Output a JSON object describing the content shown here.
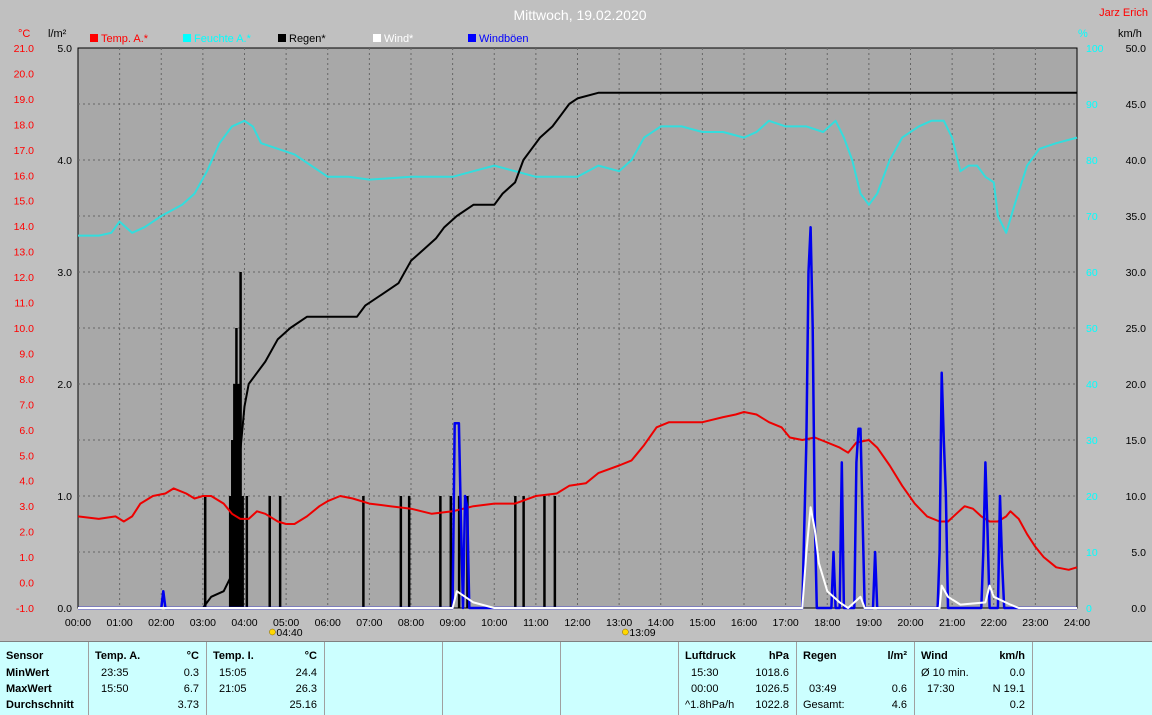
{
  "header": {
    "title": "Mittwoch, 19.02.2020",
    "author": "Jarz Erich",
    "unit_left_c": "°C",
    "unit_left_l": "l/m²",
    "unit_right_pct": "%",
    "unit_right_kmh": "km/h"
  },
  "legend": [
    {
      "label": "Temp. A.*",
      "color": "#ff0000"
    },
    {
      "label": "Feuchte A.*",
      "color": "#00ffff"
    },
    {
      "label": "Regen*",
      "color": "#000000"
    },
    {
      "label": "Wind*",
      "color": "#ffffff"
    },
    {
      "label": "Windböen",
      "color": "#0000ff"
    }
  ],
  "colors": {
    "temp": "#ee0000",
    "humidity": "#33dddd",
    "rain": "#000000",
    "wind": "#ffffff",
    "gust": "#0000ee",
    "plot_bg": "#a8a8a8",
    "grid": "#666666"
  },
  "axis_labels": {
    "temp": [
      "21.0",
      "20.0",
      "19.0",
      "18.0",
      "17.0",
      "16.0",
      "15.0",
      "14.0",
      "13.0",
      "12.0",
      "11.0",
      "10.0",
      "9.0",
      "8.0",
      "7.0",
      "6.0",
      "5.0",
      "4.0",
      "3.0",
      "2.0",
      "1.0",
      "0.0",
      "-1.0"
    ],
    "rain": [
      "5.0",
      "4.0",
      "3.0",
      "2.0",
      "1.0",
      "0.0"
    ],
    "hum": [
      "100",
      "90",
      "80",
      "70",
      "60",
      "50",
      "40",
      "30",
      "20",
      "10",
      "0"
    ],
    "wind": [
      "50.0",
      "45.0",
      "40.0",
      "35.0",
      "30.0",
      "25.0",
      "20.0",
      "15.0",
      "10.0",
      "5.0",
      "0.0"
    ],
    "time": [
      "00:00",
      "01:00",
      "02:00",
      "03:00",
      "04:00",
      "05:00",
      "06:00",
      "07:00",
      "08:00",
      "09:00",
      "10:00",
      "11:00",
      "12:00",
      "13:00",
      "14:00",
      "15:00",
      "16:00",
      "17:00",
      "18:00",
      "19:00",
      "20:00",
      "21:00",
      "22:00",
      "23:00",
      "24:00"
    ]
  },
  "sun_markers": [
    {
      "time": 4.67,
      "label": "04:40"
    },
    {
      "time": 13.15,
      "label": "13:09"
    }
  ],
  "chart_data": {
    "type": "line",
    "x_unit": "hour of day",
    "xlim": [
      0,
      24
    ],
    "axes": {
      "temp_c": [
        -1,
        21
      ],
      "rain_lm2": [
        0,
        5
      ],
      "humidity_pct": [
        0,
        100
      ],
      "wind_kmh": [
        0,
        50
      ]
    },
    "grid": true,
    "series": [
      {
        "name": "Temp. A.*",
        "axis": "temp_c",
        "points": [
          [
            0,
            2.6
          ],
          [
            0.5,
            2.5
          ],
          [
            0.9,
            2.6
          ],
          [
            1.1,
            2.4
          ],
          [
            1.3,
            2.6
          ],
          [
            1.5,
            3.1
          ],
          [
            1.8,
            3.4
          ],
          [
            2.1,
            3.5
          ],
          [
            2.3,
            3.7
          ],
          [
            2.6,
            3.5
          ],
          [
            2.8,
            3.3
          ],
          [
            3.0,
            3.4
          ],
          [
            3.2,
            3.4
          ],
          [
            3.5,
            3.1
          ],
          [
            3.7,
            2.7
          ],
          [
            3.9,
            2.5
          ],
          [
            4.1,
            2.5
          ],
          [
            4.3,
            2.8
          ],
          [
            4.5,
            2.7
          ],
          [
            4.8,
            2.4
          ],
          [
            5.0,
            2.3
          ],
          [
            5.2,
            2.3
          ],
          [
            5.5,
            2.6
          ],
          [
            5.8,
            3.0
          ],
          [
            6.0,
            3.2
          ],
          [
            6.3,
            3.4
          ],
          [
            6.6,
            3.3
          ],
          [
            7.0,
            3.1
          ],
          [
            7.5,
            3.0
          ],
          [
            8.0,
            2.9
          ],
          [
            8.5,
            2.7
          ],
          [
            9.0,
            2.8
          ],
          [
            9.5,
            3.0
          ],
          [
            10.0,
            3.1
          ],
          [
            10.5,
            3.1
          ],
          [
            11.0,
            3.4
          ],
          [
            11.5,
            3.5
          ],
          [
            11.8,
            3.8
          ],
          [
            12.2,
            3.9
          ],
          [
            12.5,
            4.3
          ],
          [
            13.0,
            4.6
          ],
          [
            13.3,
            4.8
          ],
          [
            13.6,
            5.4
          ],
          [
            13.9,
            6.1
          ],
          [
            14.2,
            6.3
          ],
          [
            14.5,
            6.3
          ],
          [
            15.0,
            6.3
          ],
          [
            15.5,
            6.5
          ],
          [
            15.8,
            6.6
          ],
          [
            16.0,
            6.7
          ],
          [
            16.3,
            6.6
          ],
          [
            16.6,
            6.3
          ],
          [
            16.9,
            6.1
          ],
          [
            17.1,
            5.7
          ],
          [
            17.4,
            5.6
          ],
          [
            17.7,
            5.7
          ],
          [
            18.0,
            5.5
          ],
          [
            18.3,
            5.3
          ],
          [
            18.5,
            5.1
          ],
          [
            18.7,
            5.5
          ],
          [
            19.0,
            5.6
          ],
          [
            19.2,
            5.3
          ],
          [
            19.5,
            4.6
          ],
          [
            19.8,
            3.8
          ],
          [
            20.1,
            3.1
          ],
          [
            20.4,
            2.6
          ],
          [
            20.7,
            2.4
          ],
          [
            20.9,
            2.4
          ],
          [
            21.1,
            2.7
          ],
          [
            21.3,
            3.0
          ],
          [
            21.5,
            2.9
          ],
          [
            21.7,
            2.6
          ],
          [
            21.9,
            2.4
          ],
          [
            22.1,
            2.4
          ],
          [
            22.3,
            2.6
          ],
          [
            22.4,
            2.8
          ],
          [
            22.6,
            2.5
          ],
          [
            22.8,
            1.9
          ],
          [
            23.0,
            1.4
          ],
          [
            23.2,
            1.0
          ],
          [
            23.5,
            0.6
          ],
          [
            23.8,
            0.5
          ],
          [
            24,
            0.6
          ]
        ]
      },
      {
        "name": "Feuchte A.*",
        "axis": "humidity_pct",
        "points": [
          [
            0,
            66.5
          ],
          [
            0.5,
            66.5
          ],
          [
            0.8,
            67
          ],
          [
            1.0,
            69
          ],
          [
            1.3,
            67
          ],
          [
            1.6,
            68
          ],
          [
            2.0,
            70
          ],
          [
            2.5,
            72
          ],
          [
            2.8,
            74
          ],
          [
            3.1,
            78
          ],
          [
            3.4,
            83
          ],
          [
            3.7,
            86
          ],
          [
            4.0,
            87
          ],
          [
            4.2,
            86
          ],
          [
            4.4,
            83
          ],
          [
            4.8,
            82
          ],
          [
            5.2,
            81
          ],
          [
            5.6,
            79
          ],
          [
            6.0,
            77
          ],
          [
            6.5,
            77
          ],
          [
            7.0,
            76.5
          ],
          [
            8.0,
            77
          ],
          [
            9.0,
            77
          ],
          [
            9.5,
            78
          ],
          [
            10.0,
            79
          ],
          [
            10.5,
            78
          ],
          [
            11.0,
            77
          ],
          [
            11.5,
            77
          ],
          [
            12.0,
            77
          ],
          [
            12.5,
            79
          ],
          [
            13.0,
            78
          ],
          [
            13.3,
            80
          ],
          [
            13.6,
            84
          ],
          [
            14.0,
            86
          ],
          [
            14.5,
            86
          ],
          [
            15.0,
            85
          ],
          [
            15.5,
            85
          ],
          [
            16.0,
            84
          ],
          [
            16.3,
            85
          ],
          [
            16.6,
            87
          ],
          [
            17.0,
            86
          ],
          [
            17.5,
            86
          ],
          [
            17.9,
            85
          ],
          [
            18.2,
            87
          ],
          [
            18.4,
            84
          ],
          [
            18.6,
            80
          ],
          [
            18.8,
            74
          ],
          [
            19.0,
            72
          ],
          [
            19.2,
            74
          ],
          [
            19.5,
            80
          ],
          [
            19.8,
            84
          ],
          [
            20.2,
            86
          ],
          [
            20.5,
            87
          ],
          [
            20.8,
            87
          ],
          [
            21.0,
            84
          ],
          [
            21.2,
            78
          ],
          [
            21.4,
            79
          ],
          [
            21.6,
            79
          ],
          [
            21.8,
            77
          ],
          [
            22.0,
            76
          ],
          [
            22.1,
            70
          ],
          [
            22.3,
            67
          ],
          [
            22.5,
            72
          ],
          [
            22.8,
            79
          ],
          [
            23.1,
            82
          ],
          [
            23.5,
            83
          ],
          [
            24,
            84
          ]
        ]
      },
      {
        "name": "Regen*",
        "axis": "rain_lm2",
        "points": [
          [
            0,
            0
          ],
          [
            3.0,
            0
          ],
          [
            3.2,
            0.1
          ],
          [
            3.5,
            0.15
          ],
          [
            3.7,
            0.3
          ],
          [
            3.8,
            0.7
          ],
          [
            3.9,
            1.4
          ],
          [
            4.0,
            1.8
          ],
          [
            4.1,
            2.0
          ],
          [
            4.3,
            2.1
          ],
          [
            4.5,
            2.2
          ],
          [
            4.8,
            2.4
          ],
          [
            5.1,
            2.5
          ],
          [
            5.5,
            2.6
          ],
          [
            6.0,
            2.6
          ],
          [
            6.7,
            2.6
          ],
          [
            6.9,
            2.7
          ],
          [
            7.3,
            2.8
          ],
          [
            7.7,
            2.9
          ],
          [
            8.0,
            3.1
          ],
          [
            8.3,
            3.2
          ],
          [
            8.6,
            3.3
          ],
          [
            8.8,
            3.4
          ],
          [
            9.1,
            3.5
          ],
          [
            9.5,
            3.6
          ],
          [
            10.0,
            3.6
          ],
          [
            10.2,
            3.7
          ],
          [
            10.5,
            3.8
          ],
          [
            10.7,
            4.0
          ],
          [
            10.9,
            4.1
          ],
          [
            11.1,
            4.2
          ],
          [
            11.4,
            4.3
          ],
          [
            11.6,
            4.4
          ],
          [
            11.8,
            4.5
          ],
          [
            12.0,
            4.55
          ],
          [
            12.5,
            4.6
          ],
          [
            24,
            4.6
          ]
        ]
      },
      {
        "name": "Windböen",
        "axis": "wind_kmh",
        "points": [
          [
            0,
            0
          ],
          [
            2.0,
            0
          ],
          [
            2.05,
            1.5
          ],
          [
            2.1,
            0
          ],
          [
            9.0,
            0
          ],
          [
            9.05,
            16.5
          ],
          [
            9.1,
            16.5
          ],
          [
            9.15,
            16.5
          ],
          [
            9.2,
            8
          ],
          [
            9.25,
            0
          ],
          [
            9.3,
            10
          ],
          [
            9.35,
            9
          ],
          [
            9.4,
            0
          ],
          [
            17.4,
            0
          ],
          [
            17.5,
            15
          ],
          [
            17.55,
            30
          ],
          [
            17.6,
            34
          ],
          [
            17.65,
            25
          ],
          [
            17.7,
            8
          ],
          [
            17.75,
            0
          ],
          [
            18.1,
            0
          ],
          [
            18.15,
            5
          ],
          [
            18.2,
            0
          ],
          [
            18.3,
            0
          ],
          [
            18.35,
            13
          ],
          [
            18.4,
            0
          ],
          [
            18.65,
            0
          ],
          [
            18.7,
            13
          ],
          [
            18.75,
            16
          ],
          [
            18.8,
            16
          ],
          [
            18.85,
            8
          ],
          [
            18.9,
            0
          ],
          [
            19.1,
            0
          ],
          [
            19.15,
            5
          ],
          [
            19.2,
            0
          ],
          [
            20.65,
            0
          ],
          [
            20.7,
            5
          ],
          [
            20.75,
            21
          ],
          [
            20.8,
            15
          ],
          [
            20.85,
            10
          ],
          [
            20.9,
            0
          ],
          [
            21.7,
            0
          ],
          [
            21.75,
            5
          ],
          [
            21.8,
            13
          ],
          [
            21.85,
            7
          ],
          [
            21.9,
            0
          ],
          [
            22.1,
            0
          ],
          [
            22.15,
            10
          ],
          [
            22.2,
            4
          ],
          [
            22.25,
            0
          ],
          [
            24,
            0
          ]
        ]
      },
      {
        "name": "Wind*",
        "axis": "wind_kmh",
        "points": [
          [
            0,
            0
          ],
          [
            9.0,
            0
          ],
          [
            9.1,
            1.5
          ],
          [
            9.3,
            1.0
          ],
          [
            9.5,
            0.5
          ],
          [
            10.0,
            0
          ],
          [
            17.4,
            0
          ],
          [
            17.5,
            5
          ],
          [
            17.6,
            9
          ],
          [
            17.7,
            7
          ],
          [
            17.8,
            4
          ],
          [
            18.0,
            1.5
          ],
          [
            18.3,
            0.5
          ],
          [
            18.5,
            0
          ],
          [
            18.8,
            1
          ],
          [
            18.9,
            0
          ],
          [
            20.7,
            0
          ],
          [
            20.75,
            2
          ],
          [
            20.9,
            1
          ],
          [
            21.2,
            0.3
          ],
          [
            21.8,
            0.5
          ],
          [
            21.9,
            2
          ],
          [
            22.0,
            1
          ],
          [
            22.4,
            0.3
          ],
          [
            22.6,
            0
          ],
          [
            24,
            0
          ]
        ]
      }
    ],
    "rain_bars_time": [
      3.05,
      3.65,
      3.7,
      3.75,
      3.8,
      3.85,
      3.9,
      3.95,
      4.05,
      4.6,
      4.85,
      6.85,
      7.75,
      7.95,
      8.7,
      8.95,
      9.15,
      9.35,
      10.5,
      10.7,
      11.2,
      11.45
    ],
    "rain_bars_height": [
      0.2,
      0.2,
      0.3,
      0.4,
      0.5,
      0.4,
      0.6,
      0.2,
      0.2,
      0.2,
      0.2,
      0.2,
      0.2,
      0.2,
      0.2,
      0.2,
      0.2,
      0.2,
      0.2,
      0.2,
      0.2,
      0.2
    ]
  },
  "stats": {
    "sensor_head": "Sensor",
    "min_label": "MinWert",
    "max_label": "MaxWert",
    "avg_label": "Durchschnitt",
    "temp_a": {
      "head": "Temp. A.",
      "unit": "°C",
      "min_time": "23:35",
      "min_val": "0.3",
      "max_time": "15:50",
      "max_val": "6.7",
      "avg": "3.73"
    },
    "temp_i": {
      "head": "Temp. I.",
      "unit": "°C",
      "min_time": "15:05",
      "min_val": "24.4",
      "max_time": "21:05",
      "max_val": "26.3",
      "avg": "25.16"
    },
    "pressure": {
      "head": "Luftdruck",
      "unit": "hPa",
      "r1_time": "15:30",
      "r1_val": "1018.6",
      "r2_time": "00:00",
      "r2_val": "1026.5",
      "r3_label": "^1.8hPa/h",
      "r3_val": "1022.8"
    },
    "rain": {
      "head": "Regen",
      "unit": "l/m²",
      "r2_time": "03:49",
      "r2_val": "0.6",
      "r3_label": "Gesamt:",
      "r3_val": "4.6"
    },
    "wind": {
      "head": "Wind",
      "unit": "km/h",
      "r1_label": "Ø 10 min.",
      "r1_val": "0.0",
      "r2_time": "17:30",
      "r2_val": "N 19.1",
      "r3_val": "0.2"
    }
  }
}
